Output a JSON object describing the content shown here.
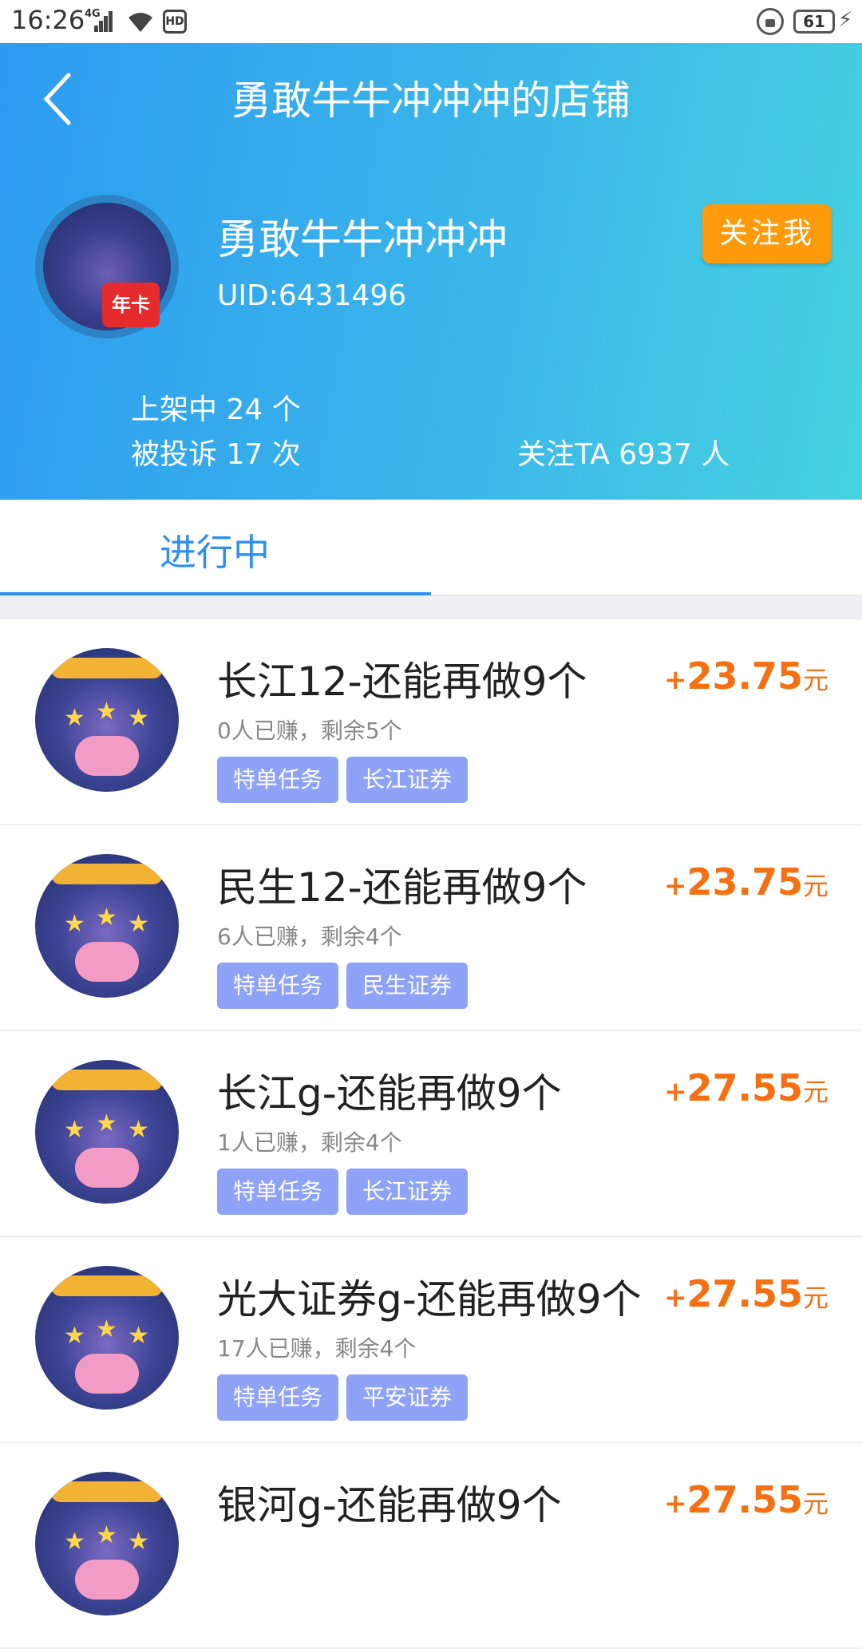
{
  "status_bar": {
    "time": "16:26",
    "network": "4G",
    "battery": "61"
  },
  "header": {
    "title": "勇敢牛牛冲冲冲的店铺",
    "shop_name": "勇敢牛牛冲冲冲",
    "uid": "UID:6431496",
    "follow_button": "关注我",
    "avatar_badge": "年卡",
    "stats": {
      "listed": "上架中 24 个",
      "complaints": "被投诉 17 次",
      "followers": "关注TA 6937 人"
    }
  },
  "tabs": {
    "active": "进行中"
  },
  "tasks": [
    {
      "title": "长江12-还能再做9个",
      "subtitle": "0人已赚，剩余5个",
      "tags": [
        "特单任务",
        "长江证券"
      ],
      "price_plus": "+",
      "price": "23.75",
      "unit": "元"
    },
    {
      "title": "民生12-还能再做9个",
      "subtitle": "6人已赚，剩余4个",
      "tags": [
        "特单任务",
        "民生证券"
      ],
      "price_plus": "+",
      "price": "23.75",
      "unit": "元"
    },
    {
      "title": "长江g-还能再做9个",
      "subtitle": "1人已赚，剩余4个",
      "tags": [
        "特单任务",
        "长江证券"
      ],
      "price_plus": "+",
      "price": "27.55",
      "unit": "元"
    },
    {
      "title": "光大证券g-还能再做9个",
      "subtitle": "17人已赚，剩余4个",
      "tags": [
        "特单任务",
        "平安证券"
      ],
      "price_plus": "+",
      "price": "27.55",
      "unit": "元"
    },
    {
      "title": "银河g-还能再做9个",
      "subtitle": "",
      "tags": [],
      "price_plus": "+",
      "price": "27.55",
      "unit": "元"
    }
  ],
  "colors": {
    "accent_blue": "#2d8ff0",
    "price_orange": "#f47012",
    "follow_orange": "#ff9a0a",
    "tag_purple": "#8ea3f8"
  }
}
